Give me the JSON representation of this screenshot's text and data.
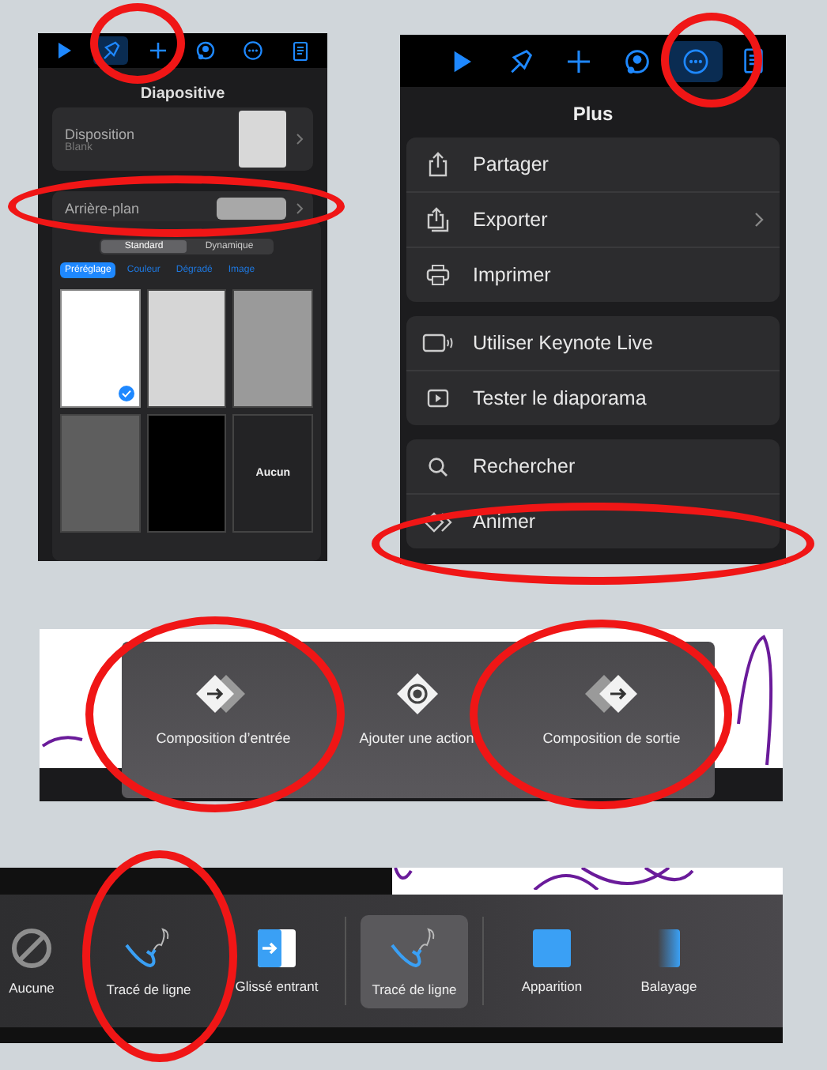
{
  "format_panel": {
    "toolbar": [
      {
        "kind": "play",
        "selected": false
      },
      {
        "kind": "brush",
        "selected": true
      },
      {
        "kind": "add",
        "selected": false
      },
      {
        "kind": "collab",
        "selected": false
      },
      {
        "kind": "more",
        "selected": false
      },
      {
        "kind": "notes",
        "selected": false
      }
    ],
    "title": "Diapositive",
    "layout_row": {
      "label": "Disposition",
      "value": "Blank"
    },
    "background_row": {
      "label": "Arrière-plan"
    },
    "segments": [
      {
        "label": "Standard",
        "selected": true
      },
      {
        "label": "Dynamique",
        "selected": false
      }
    ],
    "tabs": [
      {
        "label": "Préréglage",
        "selected": true
      },
      {
        "label": "Couleur",
        "selected": false
      },
      {
        "label": "Dégradé",
        "selected": false
      },
      {
        "label": "Image",
        "selected": false
      }
    ],
    "swatches": [
      {
        "kind": "color",
        "color": "#ffffff",
        "selected": true
      },
      {
        "kind": "color",
        "color": "#d6d6d6",
        "selected": false
      },
      {
        "kind": "color",
        "color": "#9a9a9a",
        "selected": false
      },
      {
        "kind": "color",
        "color": "#5e5e5e",
        "selected": false
      },
      {
        "kind": "color",
        "color": "#000000",
        "selected": false
      },
      {
        "kind": "none",
        "label": "Aucun",
        "selected": false
      }
    ]
  },
  "more_panel": {
    "toolbar": [
      {
        "kind": "play",
        "selected": false
      },
      {
        "kind": "brush",
        "selected": false
      },
      {
        "kind": "add",
        "selected": false
      },
      {
        "kind": "collab",
        "selected": false
      },
      {
        "kind": "more",
        "selected": true
      },
      {
        "kind": "notes",
        "selected": false
      }
    ],
    "title": "Plus",
    "groups": [
      [
        {
          "kind": "share",
          "label": "Partager",
          "submenu": false
        },
        {
          "kind": "export",
          "label": "Exporter",
          "submenu": true
        },
        {
          "kind": "print",
          "label": "Imprimer",
          "submenu": false
        }
      ],
      [
        {
          "kind": "live",
          "label": "Utiliser Keynote Live",
          "submenu": false
        },
        {
          "kind": "rehearse",
          "label": "Tester le diaporama",
          "submenu": false
        }
      ],
      [
        {
          "kind": "search",
          "label": "Rechercher",
          "submenu": false
        },
        {
          "kind": "animate",
          "label": "Animer",
          "submenu": false
        }
      ]
    ]
  },
  "animate_popover": {
    "actions": [
      {
        "kind": "build-in",
        "label": "Composition d’entrée"
      },
      {
        "kind": "action",
        "label": "Ajouter une action"
      },
      {
        "kind": "build-out",
        "label": "Composition de sortie"
      }
    ]
  },
  "transition_bar": {
    "items": [
      {
        "kind": "none",
        "label": "Aucune",
        "selected": false
      },
      {
        "kind": "line-draw",
        "label": "Tracé de ligne",
        "selected": false
      },
      {
        "kind": "move-in",
        "label": "Glissé entrant",
        "selected": false
      },
      {
        "kind": "divider"
      },
      {
        "kind": "line-draw",
        "label": "Tracé de ligne",
        "selected": true
      },
      {
        "kind": "divider"
      },
      {
        "kind": "appear",
        "label": "Apparition",
        "selected": false
      },
      {
        "kind": "wipe",
        "label": "Balayage",
        "selected": false
      }
    ]
  }
}
